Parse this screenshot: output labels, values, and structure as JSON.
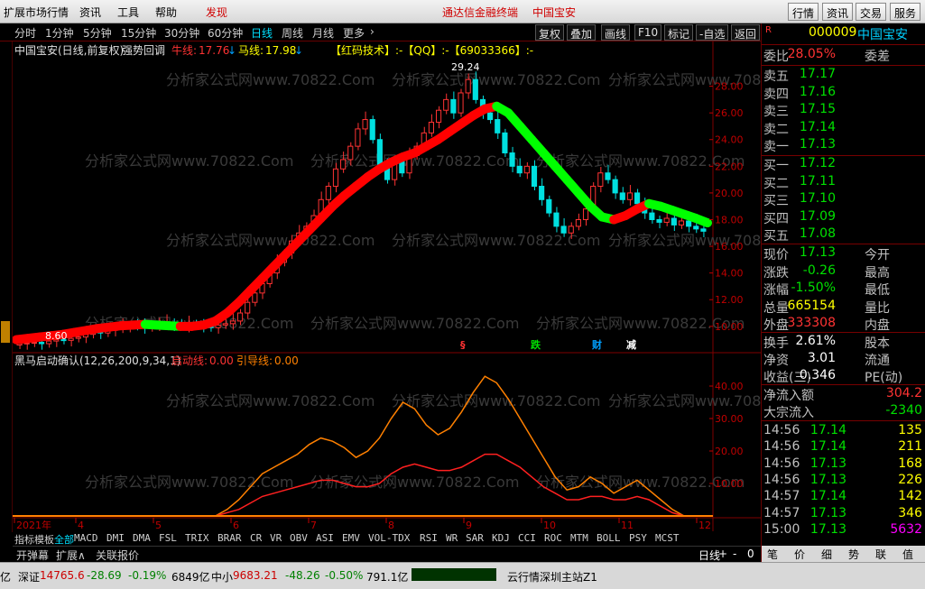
{
  "menu": {
    "items": [
      "扩展市场行情",
      "资讯",
      "工具",
      "帮助",
      "发现"
    ],
    "center_title": "通达信金融终端",
    "center_stock": "中国宝安",
    "right_buttons": [
      "行情",
      "资讯",
      "交易",
      "服务"
    ]
  },
  "periods": [
    "分时",
    "1分钟",
    "5分钟",
    "15分钟",
    "30分钟",
    "60分钟",
    "日线",
    "周线",
    "月线",
    "更多"
  ],
  "active_period": "日线",
  "toolbar": [
    "复权",
    "叠加",
    "画线",
    "F10",
    "标记",
    "-自选",
    "返回"
  ],
  "chart_header": {
    "title": "中国宝安(日线,前复权)",
    "strategy": "强势回调",
    "bull_label": "牛线:",
    "bull_value": "17.76",
    "horse_label": "马线:",
    "horse_value": "17.98",
    "info": "【红码技术】:-【QQ】:-【69033366】:-"
  },
  "indicator_header": {
    "name": "黑马启动确认(12,26,200,9,34,1)",
    "line1_label": "启动线:",
    "line1_value": "0.00",
    "line2_label": "引导线:",
    "line2_value": "0.00"
  },
  "watermark": "分析家公式网www.70822.Com",
  "chart_data": {
    "type": "candlestick",
    "price_axis": [
      "28.00",
      "26.00",
      "24.00",
      "22.00",
      "20.00",
      "18.00",
      "16.00",
      "14.00",
      "12.00",
      "10.00"
    ],
    "price_ylim": [
      8.5,
      30
    ],
    "indicator_axis": [
      "40.00",
      "30.00",
      "20.00",
      "10.00"
    ],
    "indicator_ylim": [
      0,
      45
    ],
    "months": [
      "2021年",
      "4",
      "5",
      "6",
      "7",
      "8",
      "9",
      "10",
      "11",
      "12"
    ],
    "high_label": "29.24",
    "low_label": "8.60",
    "markers": [
      {
        "text": "§",
        "color": "#ff3333"
      },
      {
        "text": "跌",
        "color": "#00e000"
      },
      {
        "text": "财",
        "color": "#00a0ff"
      },
      {
        "text": "减",
        "color": "#ffffff"
      }
    ],
    "close": [
      8.7,
      8.75,
      8.8,
      8.7,
      8.9,
      9.0,
      8.95,
      9.1,
      9.2,
      9.4,
      9.6,
      9.5,
      9.7,
      9.8,
      10.0,
      10.1,
      10.0,
      9.9,
      10.1,
      10.2,
      10.3,
      10.1,
      10.0,
      10.2,
      10.1,
      10.0,
      9.9,
      10.1,
      10.2,
      10.4,
      11.0,
      11.8,
      12.5,
      13.2,
      14.0,
      14.8,
      15.5,
      16.4,
      17.0,
      17.5,
      18.3,
      19.5,
      20.5,
      21.8,
      22.5,
      23.5,
      24.8,
      25.5,
      24.0,
      22.0,
      21.0,
      22.5,
      21.5,
      22.8,
      23.5,
      24.5,
      25.3,
      26.2,
      27.0,
      26.0,
      27.5,
      28.5,
      27.0,
      26.0,
      25.5,
      24.5,
      23.0,
      22.0,
      21.5,
      22.0,
      20.5,
      19.5,
      18.5,
      17.5,
      17.0,
      17.5,
      18.0,
      18.8,
      20.5,
      21.5,
      21.0,
      20.0,
      19.5,
      20.0,
      19.2,
      18.5,
      18.0,
      17.8,
      18.1,
      17.6,
      17.9,
      17.5,
      17.3,
      17.13
    ],
    "bull_line": [
      9.0,
      9.1,
      9.2,
      9.3,
      9.4,
      9.55,
      9.7,
      9.85,
      9.95,
      10.05,
      10.1,
      10.15,
      10.1,
      10.05,
      10.0,
      10.0,
      10.1,
      10.4,
      11.0,
      11.8,
      12.7,
      13.6,
      14.5,
      15.4,
      16.3,
      17.2,
      18.1,
      19.0,
      19.8,
      20.5,
      21.2,
      21.8,
      22.3,
      22.7,
      23.0,
      23.5,
      24.0,
      24.6,
      25.2,
      25.8,
      26.3,
      26.5,
      26.0,
      25.0,
      24.0,
      23.0,
      22.0,
      21.0,
      20.0,
      19.0,
      18.2,
      18.0,
      18.3,
      18.8,
      19.2,
      19.0,
      18.7,
      18.4,
      18.1,
      17.76
    ],
    "indicator": {
      "start_line": [
        0,
        0,
        0,
        0,
        0,
        0,
        0,
        0,
        0,
        0,
        0,
        0,
        0,
        0,
        0,
        0,
        0,
        0,
        2,
        5,
        9,
        13,
        15,
        17,
        19,
        22,
        24,
        23,
        21,
        18,
        20,
        24,
        30,
        35,
        33,
        28,
        25,
        27,
        32,
        38,
        43,
        41,
        36,
        30,
        24,
        18,
        12,
        8,
        9,
        12,
        10,
        7,
        9,
        11,
        8,
        5,
        2,
        0,
        0,
        0
      ],
      "guide_line": [
        0,
        0,
        0,
        0,
        0,
        0,
        0,
        0,
        0,
        0,
        0,
        0,
        0,
        0,
        0,
        0,
        0,
        0,
        1,
        2,
        4,
        6,
        7,
        8,
        9,
        10,
        11,
        11,
        10,
        9,
        9,
        10,
        13,
        15,
        16,
        15,
        14,
        14,
        15,
        17,
        19,
        19,
        17,
        15,
        12,
        9,
        7,
        5,
        5,
        6,
        6,
        5,
        5,
        6,
        5,
        3,
        1,
        0,
        0,
        0
      ]
    }
  },
  "bottom_tabs": [
    "指标",
    "模板",
    "全部",
    "MACD",
    "DMI",
    "DMA",
    "FSL",
    "TRIX",
    "BRAR",
    "CR",
    "VR",
    "OBV",
    "ASI",
    "EMV",
    "VOL-TDX",
    "RSI",
    "WR",
    "SAR",
    "KDJ",
    "CCI",
    "ROC",
    "MTM",
    "BOLL",
    "PSY",
    "MCST"
  ],
  "active_bottom_tab": "全部",
  "bottom_tabs2": [
    "开弹幕",
    "扩展∧",
    "关联报价"
  ],
  "bottom_right": {
    "period": "日线",
    "plus": "+",
    "minus": "-",
    "zero": "0"
  },
  "quote": {
    "code": "000009",
    "name": "中国宝安",
    "badge": "R",
    "weibi_label": "委比",
    "weibi_value": "28.05%",
    "weicha_label": "委差",
    "sells": [
      {
        "label": "卖五",
        "price": "17.17"
      },
      {
        "label": "卖四",
        "price": "17.16"
      },
      {
        "label": "卖三",
        "price": "17.15"
      },
      {
        "label": "卖二",
        "price": "17.14"
      },
      {
        "label": "卖一",
        "price": "17.13"
      }
    ],
    "buys": [
      {
        "label": "买一",
        "price": "17.12"
      },
      {
        "label": "买二",
        "price": "17.11"
      },
      {
        "label": "买三",
        "price": "17.10"
      },
      {
        "label": "买四",
        "price": "17.09"
      },
      {
        "label": "买五",
        "price": "17.08"
      }
    ],
    "stats": [
      {
        "label": "现价",
        "value": "17.13",
        "label2": "今开",
        "color": "green"
      },
      {
        "label": "涨跌",
        "value": "-0.26",
        "label2": "最高",
        "color": "green"
      },
      {
        "label": "涨幅",
        "value": "-1.50%",
        "label2": "最低",
        "color": "green"
      },
      {
        "label": "总量",
        "value": "665154",
        "label2": "量比",
        "color": "yellow"
      },
      {
        "label": "外盘",
        "value": "333308",
        "label2": "内盘",
        "color": "red"
      }
    ],
    "stats2": [
      {
        "label": "换手",
        "value": "2.61%",
        "label2": "股本"
      },
      {
        "label": "净资",
        "value": "3.01",
        "label2": "流通"
      },
      {
        "label": "收益(三)",
        "value": "0.346",
        "label2": "PE(动)"
      }
    ],
    "flows": [
      {
        "label": "净流入额",
        "value": "304.2",
        "color": "red"
      },
      {
        "label": "大宗流入",
        "value": "-2340",
        "color": "green"
      }
    ],
    "ticks": [
      {
        "time": "14:56",
        "price": "17.14",
        "vol": "135"
      },
      {
        "time": "14:56",
        "price": "17.14",
        "vol": "211"
      },
      {
        "time": "14:56",
        "price": "17.13",
        "vol": "168"
      },
      {
        "time": "14:56",
        "price": "17.13",
        "vol": "226"
      },
      {
        "time": "14:57",
        "price": "17.14",
        "vol": "142"
      },
      {
        "time": "14:57",
        "price": "17.13",
        "vol": "346"
      },
      {
        "time": "15:00",
        "price": "17.13",
        "vol": "5632"
      }
    ],
    "tabs": [
      "笔",
      "价",
      "细",
      "势",
      "联",
      "值"
    ]
  },
  "status": {
    "left_cut": "亿",
    "sz_label": "深证",
    "sz_value": "14765.6",
    "sz_change": "-28.69",
    "sz_pct": "-0.19%",
    "sz_amount": "6849亿",
    "zx_label": "中小",
    "zx_value": "9683.21",
    "zx_change": "-48.26",
    "zx_pct": "-0.50%",
    "zx_amount": "791.1亿",
    "server": "云行情深圳主站Z1"
  }
}
